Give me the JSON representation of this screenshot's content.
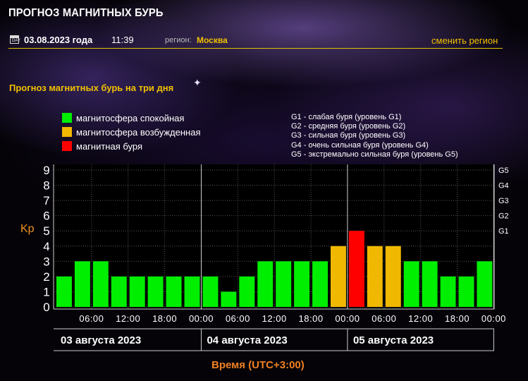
{
  "header": {
    "site_title": "ПРОГНОЗ МАГНИТНЫХ БУРЬ",
    "date": "03.08.2023 года",
    "time": "11:39",
    "region_label": "регион:",
    "region_value": "Москва",
    "change_region": "сменить регион",
    "calendar_icon_text": "DAY"
  },
  "section_title": "Прогноз магнитных бурь на три дня",
  "legend": [
    {
      "label": "магнитосфера спокойная",
      "color": "#00ee00"
    },
    {
      "label": "магнитосфера возбужденная",
      "color": "#f0b800"
    },
    {
      "label": "магнитная буря",
      "color": "#ff0000"
    }
  ],
  "g_levels": [
    "G1 - слабая буря (уровень G1)",
    "G2 - средняя буря (уровень G2)",
    "G3 - сильная буря (уровень G3)",
    "G4 - очень сильная буря (уровень G4)",
    "G5 - экстремально сильная буря (уровень G5)"
  ],
  "chart_data": {
    "type": "bar",
    "ylabel": "Kp",
    "xlabel": "Время (UTC+3:00)",
    "ylim": [
      0,
      9
    ],
    "y_ticks": [
      "0",
      "1",
      "2",
      "3",
      "4",
      "5",
      "6",
      "7",
      "8",
      "9"
    ],
    "right_ticks": [
      {
        "kp": 5,
        "label": "G1"
      },
      {
        "kp": 6,
        "label": "G2"
      },
      {
        "kp": 7,
        "label": "G3"
      },
      {
        "kp": 8,
        "label": "G4"
      },
      {
        "kp": 9,
        "label": "G5"
      }
    ],
    "x_tick_labels": [
      "06:00",
      "12:00",
      "18:00",
      "00:00",
      "06:00",
      "12:00",
      "18:00",
      "00:00",
      "06:00",
      "12:00",
      "18:00",
      "00:00"
    ],
    "day_labels": [
      "03 августа 2023",
      "04 августа 2023",
      "05 августа 2023"
    ],
    "interval_hours": 3,
    "values": [
      2,
      3,
      3,
      2,
      2,
      2,
      2,
      2,
      2,
      1,
      2,
      3,
      3,
      3,
      3,
      4,
      5,
      4,
      4,
      3,
      3,
      2,
      2,
      3
    ],
    "colors": {
      "quiet": "#00ee00",
      "active": "#f0b800",
      "storm": "#ff0000"
    },
    "grid": true
  }
}
